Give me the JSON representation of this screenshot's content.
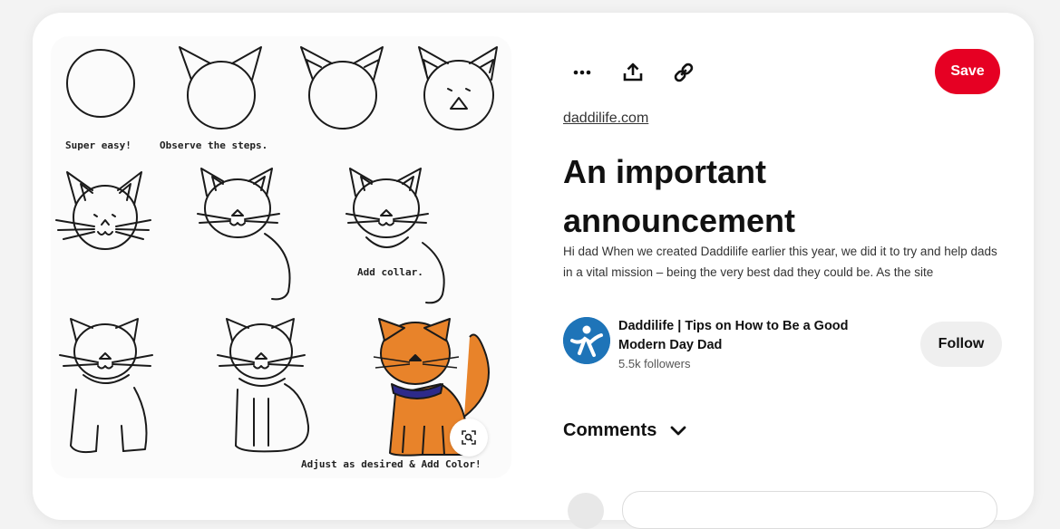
{
  "pin": {
    "captions": [
      "Super easy!",
      "Observe the steps.",
      "Add collar.",
      "Adjust as desired & Add Color!"
    ],
    "visual_search_icon": "magnifier-icon"
  },
  "toolbar": {
    "more_icon": "more-options-icon",
    "share_icon": "share-icon",
    "link_icon": "link-icon",
    "save_label": "Save"
  },
  "source": {
    "domain": "daddilife.com"
  },
  "title": "An important announcement",
  "description": "Hi dad When we created Daddilife earlier this year, we did it to try and help dads in a vital mission – being the very best dad they could be. As the site",
  "creator": {
    "name": "Daddilife | Tips on How to Be a Good Modern Day Dad",
    "followers": "5.5k followers",
    "follow_label": "Follow"
  },
  "comments": {
    "label": "Comments",
    "icon": "chevron-down-icon"
  },
  "colors": {
    "save": "#e60023",
    "cat": "#e8832a",
    "collar": "#2d2a8a",
    "avatar": "#1e74b8"
  }
}
